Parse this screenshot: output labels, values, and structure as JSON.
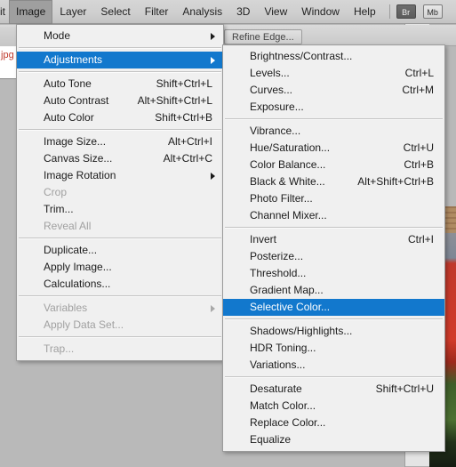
{
  "app": {
    "background_color": "#b9b9b9",
    "highlight_color": "#1278cd",
    "menu_background": "#f0f0f0"
  },
  "menubar": {
    "items": [
      {
        "label": "it",
        "clipped": true,
        "active": false
      },
      {
        "label": "Image",
        "clipped": false,
        "active": true
      },
      {
        "label": "Layer",
        "clipped": false,
        "active": false
      },
      {
        "label": "Select",
        "clipped": false,
        "active": false
      },
      {
        "label": "Filter",
        "clipped": false,
        "active": false
      },
      {
        "label": "Analysis",
        "clipped": false,
        "active": false
      },
      {
        "label": "3D",
        "clipped": false,
        "active": false
      },
      {
        "label": "View",
        "clipped": false,
        "active": false
      },
      {
        "label": "Window",
        "clipped": false,
        "active": false
      },
      {
        "label": "Help",
        "clipped": false,
        "active": false
      }
    ],
    "buttons": [
      {
        "label": "Br",
        "name": "bridge-button"
      },
      {
        "label": "Mb",
        "name": "mini-bridge-button"
      }
    ]
  },
  "options_bar": {
    "refine_edge_label": "Refine Edge..."
  },
  "document_tab": {
    "label": ".jpg"
  },
  "image_menu": {
    "title": "Image",
    "items": [
      {
        "label": "Mode",
        "accel": "",
        "submenu": true,
        "disabled": false
      },
      {
        "separator": true
      },
      {
        "label": "Adjustments",
        "accel": "",
        "submenu": true,
        "disabled": false,
        "highlight": true
      },
      {
        "separator": true
      },
      {
        "label": "Auto Tone",
        "accel": "Shift+Ctrl+L",
        "submenu": false,
        "disabled": false
      },
      {
        "label": "Auto Contrast",
        "accel": "Alt+Shift+Ctrl+L",
        "submenu": false,
        "disabled": false
      },
      {
        "label": "Auto Color",
        "accel": "Shift+Ctrl+B",
        "submenu": false,
        "disabled": false
      },
      {
        "separator": true
      },
      {
        "label": "Image Size...",
        "accel": "Alt+Ctrl+I",
        "submenu": false,
        "disabled": false
      },
      {
        "label": "Canvas Size...",
        "accel": "Alt+Ctrl+C",
        "submenu": false,
        "disabled": false
      },
      {
        "label": "Image Rotation",
        "accel": "",
        "submenu": true,
        "disabled": false
      },
      {
        "label": "Crop",
        "accel": "",
        "submenu": false,
        "disabled": true
      },
      {
        "label": "Trim...",
        "accel": "",
        "submenu": false,
        "disabled": false
      },
      {
        "label": "Reveal All",
        "accel": "",
        "submenu": false,
        "disabled": true
      },
      {
        "separator": true
      },
      {
        "label": "Duplicate...",
        "accel": "",
        "submenu": false,
        "disabled": false
      },
      {
        "label": "Apply Image...",
        "accel": "",
        "submenu": false,
        "disabled": false
      },
      {
        "label": "Calculations...",
        "accel": "",
        "submenu": false,
        "disabled": false
      },
      {
        "separator": true
      },
      {
        "label": "Variables",
        "accel": "",
        "submenu": true,
        "disabled": true
      },
      {
        "label": "Apply Data Set...",
        "accel": "",
        "submenu": false,
        "disabled": true
      },
      {
        "separator": true
      },
      {
        "label": "Trap...",
        "accel": "",
        "submenu": false,
        "disabled": true
      }
    ]
  },
  "adjustments_submenu": {
    "title": "Adjustments",
    "items": [
      {
        "label": "Brightness/Contrast...",
        "accel": "",
        "submenu": false,
        "disabled": false
      },
      {
        "label": "Levels...",
        "accel": "Ctrl+L",
        "submenu": false,
        "disabled": false
      },
      {
        "label": "Curves...",
        "accel": "Ctrl+M",
        "submenu": false,
        "disabled": false
      },
      {
        "label": "Exposure...",
        "accel": "",
        "submenu": false,
        "disabled": false
      },
      {
        "separator": true
      },
      {
        "label": "Vibrance...",
        "accel": "",
        "submenu": false,
        "disabled": false
      },
      {
        "label": "Hue/Saturation...",
        "accel": "Ctrl+U",
        "submenu": false,
        "disabled": false
      },
      {
        "label": "Color Balance...",
        "accel": "Ctrl+B",
        "submenu": false,
        "disabled": false
      },
      {
        "label": "Black & White...",
        "accel": "Alt+Shift+Ctrl+B",
        "submenu": false,
        "disabled": false
      },
      {
        "label": "Photo Filter...",
        "accel": "",
        "submenu": false,
        "disabled": false
      },
      {
        "label": "Channel Mixer...",
        "accel": "",
        "submenu": false,
        "disabled": false
      },
      {
        "separator": true
      },
      {
        "label": "Invert",
        "accel": "Ctrl+I",
        "submenu": false,
        "disabled": false
      },
      {
        "label": "Posterize...",
        "accel": "",
        "submenu": false,
        "disabled": false
      },
      {
        "label": "Threshold...",
        "accel": "",
        "submenu": false,
        "disabled": false
      },
      {
        "label": "Gradient Map...",
        "accel": "",
        "submenu": false,
        "disabled": false
      },
      {
        "label": "Selective Color...",
        "accel": "",
        "submenu": false,
        "disabled": false,
        "highlight": true
      },
      {
        "separator": true
      },
      {
        "label": "Shadows/Highlights...",
        "accel": "",
        "submenu": false,
        "disabled": false
      },
      {
        "label": "HDR Toning...",
        "accel": "",
        "submenu": false,
        "disabled": false
      },
      {
        "label": "Variations...",
        "accel": "",
        "submenu": false,
        "disabled": false
      },
      {
        "separator": true
      },
      {
        "label": "Desaturate",
        "accel": "Shift+Ctrl+U",
        "submenu": false,
        "disabled": false
      },
      {
        "label": "Match Color...",
        "accel": "",
        "submenu": false,
        "disabled": false
      },
      {
        "label": "Replace Color...",
        "accel": "",
        "submenu": false,
        "disabled": false
      },
      {
        "label": "Equalize",
        "accel": "",
        "submenu": false,
        "disabled": false
      }
    ]
  }
}
